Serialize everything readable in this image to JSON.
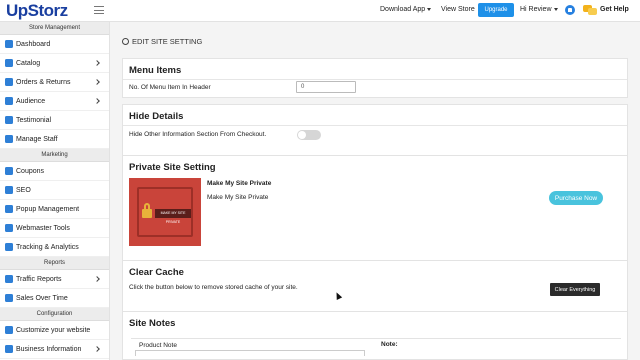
{
  "topbar": {
    "logo": "UpStorz",
    "download_app": "Download App",
    "view_store": "View Store",
    "upgrade": "Upgrade",
    "greeting": "Hi Review",
    "get_help": "Get Help"
  },
  "sidebar": {
    "sections": [
      {
        "title": "Store Management",
        "items": [
          {
            "label": "Dashboard",
            "icon": "home-icon",
            "chevron": false
          },
          {
            "label": "Catalog",
            "icon": "catalog-icon",
            "chevron": true
          },
          {
            "label": "Orders & Returns",
            "icon": "cart-icon",
            "chevron": true
          },
          {
            "label": "Audience",
            "icon": "users-icon",
            "chevron": true
          },
          {
            "label": "Testimonial",
            "icon": "testimonial-icon",
            "chevron": false
          },
          {
            "label": "Manage Staff",
            "icon": "staff-icon",
            "chevron": false
          }
        ]
      },
      {
        "title": "Marketing",
        "items": [
          {
            "label": "Coupons",
            "icon": "coupon-icon",
            "chevron": false
          },
          {
            "label": "SEO",
            "icon": "seo-icon",
            "chevron": false
          },
          {
            "label": "Popup Management",
            "icon": "popup-icon",
            "chevron": false
          },
          {
            "label": "Webmaster Tools",
            "icon": "webmaster-icon",
            "chevron": false
          },
          {
            "label": "Tracking & Analytics",
            "icon": "analytics-icon",
            "chevron": false
          }
        ]
      },
      {
        "title": "Reports",
        "items": [
          {
            "label": "Traffic Reports",
            "icon": "traffic-icon",
            "chevron": true
          },
          {
            "label": "Sales Over Time",
            "icon": "sales-icon",
            "chevron": false
          }
        ]
      },
      {
        "title": "Configuration",
        "items": [
          {
            "label": "Customize your website",
            "icon": "customize-icon",
            "chevron": false
          },
          {
            "label": "Business Information",
            "icon": "business-icon",
            "chevron": true
          }
        ]
      }
    ]
  },
  "main": {
    "page_title": "EDIT SITE SETTING",
    "menu_items": {
      "title": "Menu Items",
      "label": "No. Of Menu Item In Header",
      "value": "0"
    },
    "hide_details": {
      "title": "Hide Details",
      "label": "Hide Other Information Section From Checkout."
    },
    "private_site": {
      "title": "Private Site Setting",
      "image_banner": "MAKE MY SITE PRIVATE",
      "heading": "Make My Site Private",
      "description": "Make My Site Private",
      "button": "Purchase Now"
    },
    "clear_cache": {
      "title": "Clear Cache",
      "description": "Click the button below to remove stored cache of your site.",
      "button": "Clear Everything"
    },
    "site_notes": {
      "title": "Site Notes",
      "product_note_label": "Product Note",
      "note_label": "Note:"
    }
  }
}
